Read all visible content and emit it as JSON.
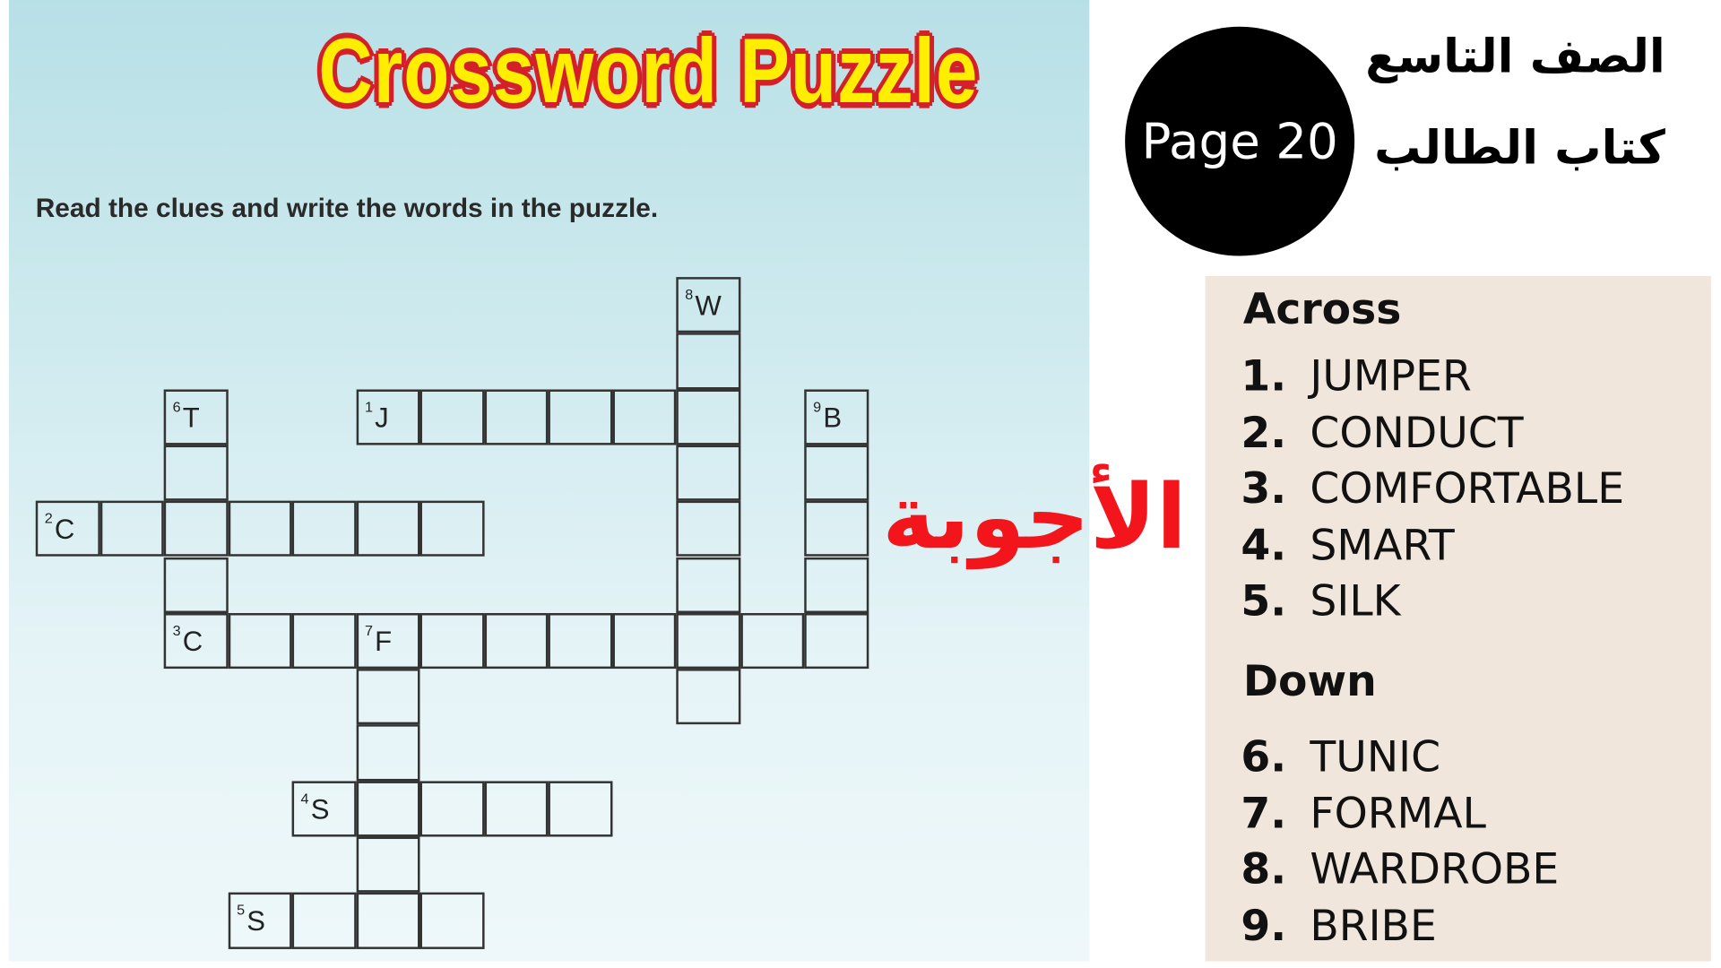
{
  "title": "Crossword Puzzle",
  "instruction": "Read the clues and write the words in the puzzle.",
  "answers_label": "الأجوبة",
  "page_badge": "Page 20",
  "grade": "الصف التاسع",
  "book": "كتاب الطالب",
  "colors": {
    "title_fill": "#ffee00",
    "title_outline": "#d4202a",
    "answers_label": "#f2161c",
    "panel": "#f0e6db"
  },
  "grid": {
    "clues": [
      {
        "number": "1",
        "letter": "J",
        "direction": "across"
      },
      {
        "number": "2",
        "letter": "C",
        "direction": "across"
      },
      {
        "number": "3",
        "letter": "C",
        "direction": "across"
      },
      {
        "number": "4",
        "letter": "S",
        "direction": "across"
      },
      {
        "number": "5",
        "letter": "S",
        "direction": "across"
      },
      {
        "number": "6",
        "letter": "T",
        "direction": "down"
      },
      {
        "number": "7",
        "letter": "F",
        "direction": "down"
      },
      {
        "number": "8",
        "letter": "W",
        "direction": "down"
      },
      {
        "number": "9",
        "letter": "B",
        "direction": "down"
      }
    ]
  },
  "across": {
    "heading": "Across",
    "items": [
      {
        "n": "1.",
        "word": "JUMPER"
      },
      {
        "n": "2.",
        "word": "CONDUCT"
      },
      {
        "n": "3.",
        "word": "COMFORTABLE"
      },
      {
        "n": "4.",
        "word": "SMART"
      },
      {
        "n": "5.",
        "word": "SILK"
      }
    ]
  },
  "down": {
    "heading": "Down",
    "items": [
      {
        "n": "6.",
        "word": "TUNIC"
      },
      {
        "n": "7.",
        "word": "FORMAL"
      },
      {
        "n": "8.",
        "word": "WARDROBE"
      },
      {
        "n": "9.",
        "word": "BRIBE"
      }
    ]
  }
}
